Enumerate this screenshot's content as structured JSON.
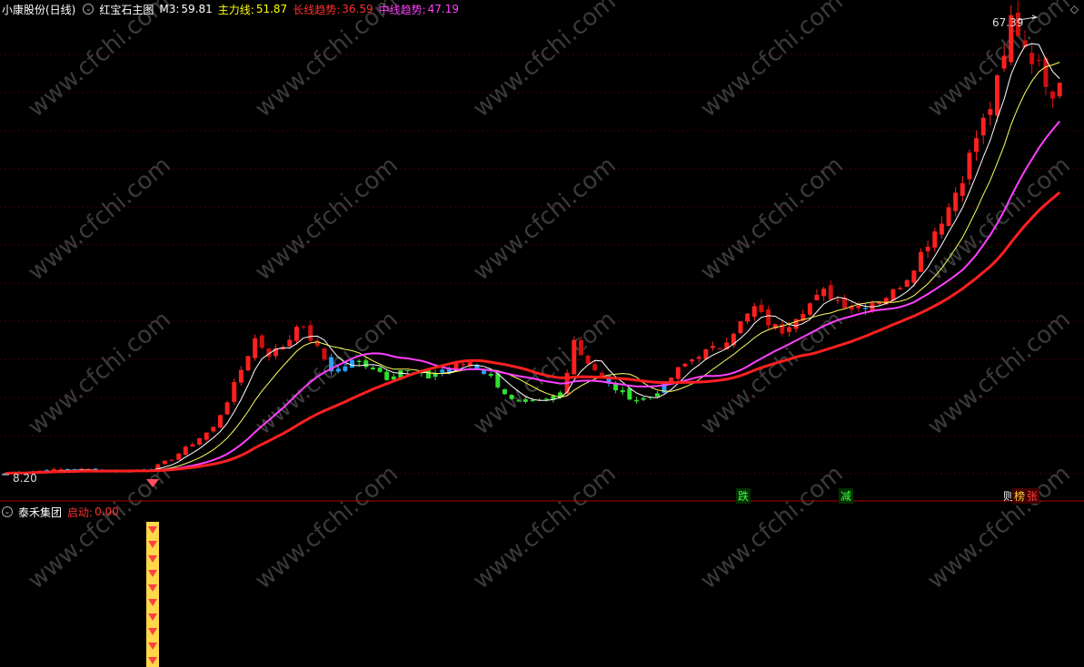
{
  "header": {
    "stock_name": "小康股份(日线)",
    "indicator_name": "红宝石主图",
    "items": [
      {
        "label": "M3:",
        "value": "59.81",
        "color": "#ffffff"
      },
      {
        "label": "主力线:",
        "value": "51.87",
        "color": "#ffff00"
      },
      {
        "label": "长线趋势:",
        "value": "36.59",
        "color": "#ff3030"
      },
      {
        "label": "中线趋势:",
        "value": "47.19",
        "color": "#ff40ff"
      }
    ]
  },
  "sub_header": {
    "indicator_name": "泰禾集团",
    "label": "启动:",
    "value": "0.00",
    "color": "#ff3030"
  },
  "markers": {
    "high_label": "67.39",
    "low_label": "8.20",
    "signals": [
      {
        "text": "跌",
        "color": "#40ff40"
      },
      {
        "text": "减",
        "color": "#40ff40"
      },
      {
        "text": "则",
        "color": "#ffffff"
      },
      {
        "text": "榜",
        "color": "#ffd040"
      },
      {
        "text": "张",
        "color": "#ff4040"
      }
    ]
  },
  "watermark": "www.cfchi.com",
  "chart_data": {
    "type": "candlestick",
    "title": "红宝石主图",
    "price_range": [
      8.2,
      67.39
    ],
    "series": [
      {
        "name": "M3",
        "color": "#ffffff",
        "last": 59.81
      },
      {
        "name": "主力线",
        "color": "#ffff00",
        "last": 51.87
      },
      {
        "name": "长线趋势",
        "color": "#ff3030",
        "last": 36.59
      },
      {
        "name": "中线趋势",
        "color": "#ff40ff",
        "last": 47.19
      }
    ],
    "close_path": [
      [
        0,
        8.6
      ],
      [
        3,
        8.8
      ],
      [
        6,
        9.0
      ],
      [
        9,
        9.0
      ],
      [
        12,
        9.1
      ],
      [
        15,
        8.9
      ],
      [
        18,
        9.0
      ],
      [
        21,
        9.2
      ],
      [
        22,
        9.6
      ],
      [
        24,
        10.5
      ],
      [
        27,
        12.5
      ],
      [
        30,
        14.5
      ],
      [
        32,
        18
      ],
      [
        34,
        22
      ],
      [
        36,
        26
      ],
      [
        38,
        24
      ],
      [
        40,
        25
      ],
      [
        41,
        26
      ],
      [
        42,
        28
      ],
      [
        44,
        26
      ],
      [
        47,
        22
      ],
      [
        48,
        22
      ],
      [
        50,
        23
      ],
      [
        53,
        22.5
      ],
      [
        55,
        21
      ],
      [
        57,
        22
      ],
      [
        59,
        21.5
      ],
      [
        61,
        21
      ],
      [
        63,
        22
      ],
      [
        65,
        22.5
      ],
      [
        67,
        23
      ],
      [
        70,
        21
      ],
      [
        73,
        18
      ],
      [
        75,
        17.5
      ],
      [
        78,
        18
      ],
      [
        80,
        19
      ],
      [
        81,
        22
      ],
      [
        82,
        26
      ],
      [
        83,
        24
      ],
      [
        85,
        22
      ],
      [
        87,
        20
      ],
      [
        89,
        19
      ],
      [
        91,
        18
      ],
      [
        93,
        18.5
      ],
      [
        95,
        20
      ],
      [
        97,
        22
      ],
      [
        100,
        24
      ],
      [
        103,
        25
      ],
      [
        106,
        28
      ],
      [
        108,
        30
      ],
      [
        110,
        28
      ],
      [
        112,
        27
      ],
      [
        114,
        29
      ],
      [
        116,
        30.5
      ],
      [
        118,
        32
      ],
      [
        120,
        31
      ],
      [
        122,
        30
      ],
      [
        124,
        30.5
      ],
      [
        126,
        31
      ],
      [
        128,
        32
      ],
      [
        130,
        34
      ],
      [
        132,
        37
      ],
      [
        134,
        40
      ],
      [
        136,
        43
      ],
      [
        138,
        47
      ],
      [
        140,
        52
      ],
      [
        142,
        56
      ],
      [
        144,
        62
      ],
      [
        145,
        67.39
      ],
      [
        147,
        64
      ],
      [
        149,
        61
      ],
      [
        151,
        58
      ],
      [
        152,
        59.81
      ]
    ],
    "ma_fast_last": 51.87,
    "ma_mid_last": 47.19,
    "ma_long_last": 36.59,
    "sub_signal_value": 0.0
  }
}
